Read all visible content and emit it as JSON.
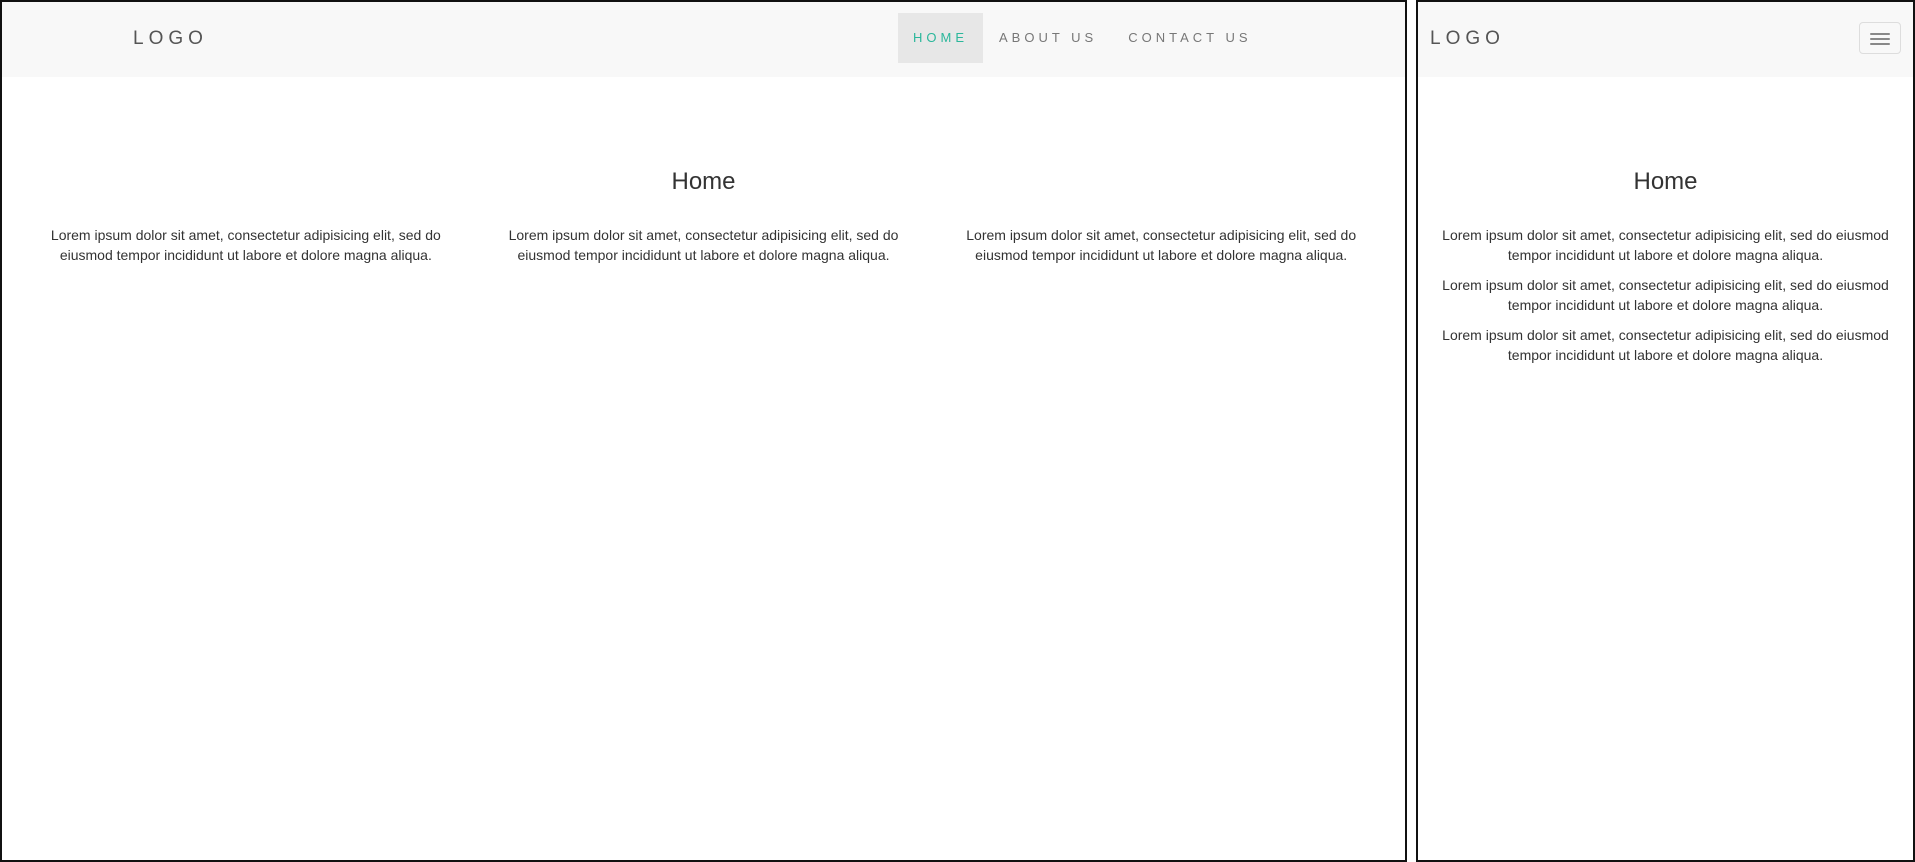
{
  "desktop": {
    "logo": "LOGO",
    "nav": [
      {
        "label": "HOME",
        "active": true
      },
      {
        "label": "ABOUT US",
        "active": false
      },
      {
        "label": "CONTACT US",
        "active": false
      }
    ],
    "title": "Home",
    "columns": [
      "Lorem ipsum dolor sit amet, consectetur adipisicing elit, sed do eiusmod tempor incididunt ut labore et dolore magna aliqua.",
      "Lorem ipsum dolor sit amet, consectetur adipisicing elit, sed do eiusmod tempor incididunt ut labore et dolore magna aliqua.",
      "Lorem ipsum dolor sit amet, consectetur adipisicing elit, sed do eiusmod tempor incididunt ut labore et dolore magna aliqua."
    ]
  },
  "mobile": {
    "logo": "LOGO",
    "menu_icon": "hamburger-menu-icon",
    "title": "Home",
    "paragraphs": [
      "Lorem ipsum dolor sit amet, consectetur adipisicing elit, sed do eiusmod tempor incididunt ut labore et dolore magna aliqua.",
      "Lorem ipsum dolor sit amet, consectetur adipisicing elit, sed do eiusmod tempor incididunt ut labore et dolore magna aliqua.",
      "Lorem ipsum dolor sit amet, consectetur adipisicing elit, sed do eiusmod tempor incididunt ut labore et dolore magna aliqua."
    ]
  },
  "colors": {
    "accent": "#2bb79b",
    "navbar_bg": "#f8f8f8",
    "active_nav_bg": "#e7e7e7",
    "text": "#333333"
  }
}
